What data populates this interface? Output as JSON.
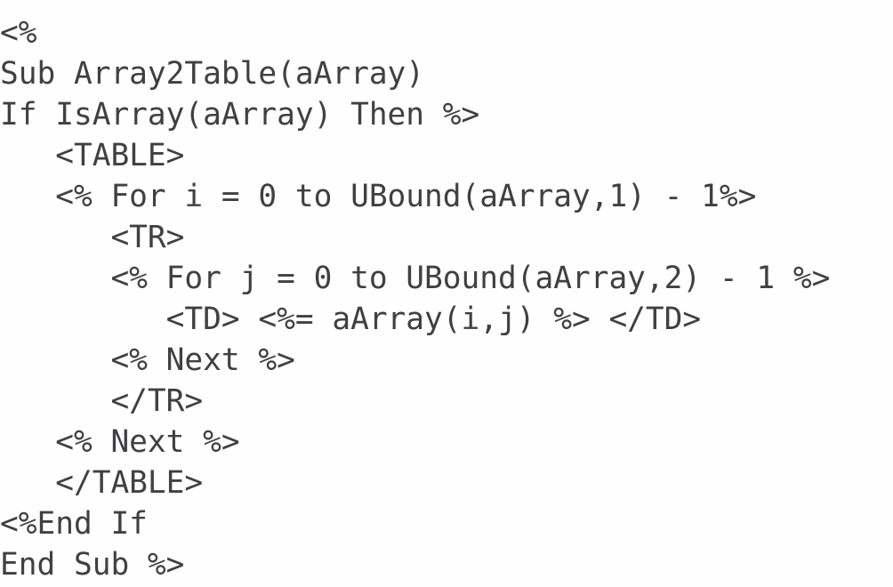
{
  "document": {
    "kind": "code-listing",
    "language": "Classic ASP / VBScript",
    "background_color": "#fefefe",
    "text_color": "#404042"
  },
  "code": {
    "lines": [
      "<%",
      "Sub Array2Table(aArray)",
      "If IsArray(aArray) Then %>",
      "   <TABLE>",
      "   <% For i = 0 to UBound(aArray,1) - 1%>",
      "      <TR>",
      "      <% For j = 0 to UBound(aArray,2) - 1 %>",
      "         <TD> <%= aArray(i,j) %> </TD>",
      "      <% Next %>",
      "      </TR>",
      "   <% Next %>",
      "   </TABLE>",
      "<%End If",
      "End Sub %>"
    ]
  }
}
